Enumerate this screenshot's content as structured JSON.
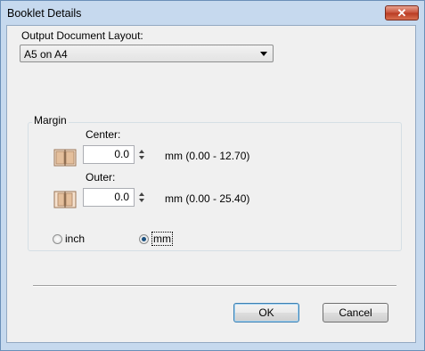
{
  "window": {
    "title": "Booklet Details",
    "close_label": "✕"
  },
  "layout_section": {
    "label": "Output Document Layout:",
    "selected": "A5 on A4"
  },
  "margin": {
    "legend": "Margin",
    "center": {
      "label": "Center:",
      "value": "0.0",
      "range": "mm (0.00 - 12.70)"
    },
    "outer": {
      "label": "Outer:",
      "value": "0.0",
      "range": "mm (0.00 - 25.40)"
    },
    "units": {
      "inch_label": "inch",
      "mm_label": "mm",
      "selected": "mm"
    }
  },
  "buttons": {
    "ok": "OK",
    "cancel": "Cancel"
  },
  "colors": {
    "titlebar": "#c6d9ee",
    "client": "#f0f0f0",
    "close": "#c8513a",
    "book_icon": "#d9ac85"
  }
}
